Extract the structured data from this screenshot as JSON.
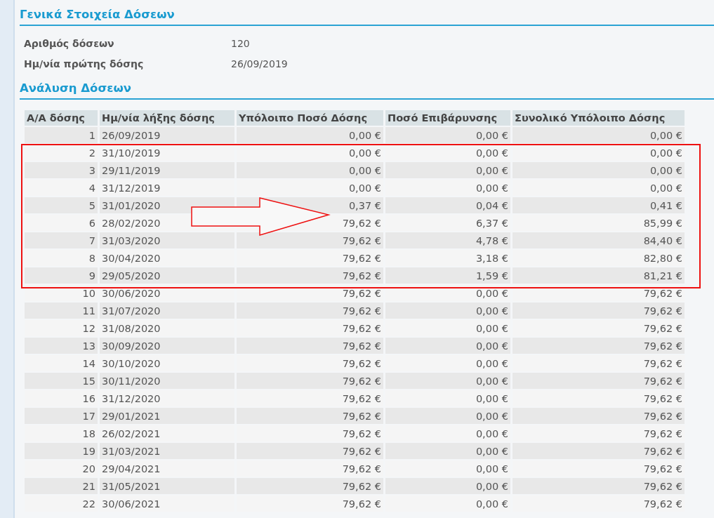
{
  "general": {
    "title": "Γενικά Στοιχεία Δόσεων",
    "fields": [
      {
        "label": "Αριθμός δόσεων",
        "value": "120"
      },
      {
        "label": "Ημ/νία πρώτης δόσης",
        "value": "26/09/2019"
      }
    ]
  },
  "analysis": {
    "title": "Ανάλυση Δόσεων",
    "table": {
      "columns": [
        "Α/Α δόσης",
        "Ημ/νία λήξης δόσης",
        "Υπόλοιπο Ποσό Δόσης",
        "Ποσό Επιβάρυνσης",
        "Συνολικό Υπόλοιπο Δόσης"
      ],
      "rows": [
        [
          "1",
          "26/09/2019",
          "0,00 €",
          "0,00 €",
          "0,00 €"
        ],
        [
          "2",
          "31/10/2019",
          "0,00 €",
          "0,00 €",
          "0,00 €"
        ],
        [
          "3",
          "29/11/2019",
          "0,00 €",
          "0,00 €",
          "0,00 €"
        ],
        [
          "4",
          "31/12/2019",
          "0,00 €",
          "0,00 €",
          "0,00 €"
        ],
        [
          "5",
          "31/01/2020",
          "0,37 €",
          "0,04 €",
          "0,41 €"
        ],
        [
          "6",
          "28/02/2020",
          "79,62 €",
          "6,37 €",
          "85,99 €"
        ],
        [
          "7",
          "31/03/2020",
          "79,62 €",
          "4,78 €",
          "84,40 €"
        ],
        [
          "8",
          "30/04/2020",
          "79,62 €",
          "3,18 €",
          "82,80 €"
        ],
        [
          "9",
          "29/05/2020",
          "79,62 €",
          "1,59 €",
          "81,21 €"
        ],
        [
          "10",
          "30/06/2020",
          "79,62 €",
          "0,00 €",
          "79,62 €"
        ],
        [
          "11",
          "31/07/2020",
          "79,62 €",
          "0,00 €",
          "79,62 €"
        ],
        [
          "12",
          "31/08/2020",
          "79,62 €",
          "0,00 €",
          "79,62 €"
        ],
        [
          "13",
          "30/09/2020",
          "79,62 €",
          "0,00 €",
          "79,62 €"
        ],
        [
          "14",
          "30/10/2020",
          "79,62 €",
          "0,00 €",
          "79,62 €"
        ],
        [
          "15",
          "30/11/2020",
          "79,62 €",
          "0,00 €",
          "79,62 €"
        ],
        [
          "16",
          "31/12/2020",
          "79,62 €",
          "0,00 €",
          "79,62 €"
        ],
        [
          "17",
          "29/01/2021",
          "79,62 €",
          "0,00 €",
          "79,62 €"
        ],
        [
          "18",
          "26/02/2021",
          "79,62 €",
          "0,00 €",
          "79,62 €"
        ],
        [
          "19",
          "31/03/2021",
          "79,62 €",
          "0,00 €",
          "79,62 €"
        ],
        [
          "20",
          "29/04/2021",
          "79,62 €",
          "0,00 €",
          "79,62 €"
        ],
        [
          "21",
          "31/05/2021",
          "79,62 €",
          "0,00 €",
          "79,62 €"
        ],
        [
          "22",
          "30/06/2021",
          "79,62 €",
          "0,00 €",
          "79,62 €"
        ]
      ]
    }
  }
}
